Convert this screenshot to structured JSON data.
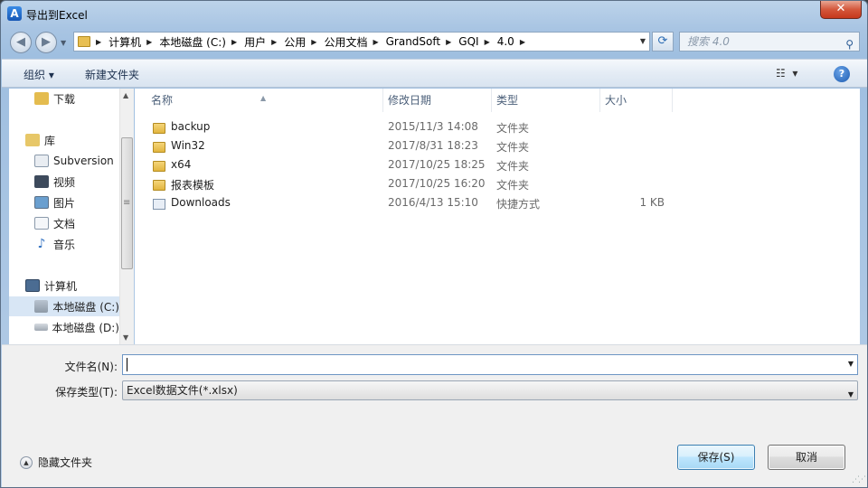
{
  "window": {
    "title": "导出到Excel",
    "app_icon_letter": "A",
    "close_glyph": "✕"
  },
  "address": {
    "crumbs": [
      "计算机",
      "本地磁盘 (C:)",
      "用户",
      "公用",
      "公用文档",
      "GrandSoft",
      "GQI",
      "4.0"
    ],
    "search_placeholder": "搜索 4.0"
  },
  "toolbar": {
    "organize_label": "组织 ▾",
    "new_folder_label": "新建文件夹",
    "help_glyph": "?"
  },
  "sidebar": {
    "items": [
      {
        "label": "下载",
        "icon": "download-folder-icon"
      },
      {
        "label": "库",
        "icon": "library-icon"
      },
      {
        "label": "Subversion",
        "icon": "subversion-library-icon"
      },
      {
        "label": "视频",
        "icon": "video-icon"
      },
      {
        "label": "图片",
        "icon": "picture-icon"
      },
      {
        "label": "文档",
        "icon": "document-icon"
      },
      {
        "label": "音乐",
        "icon": "music-icon"
      },
      {
        "label": "计算机",
        "icon": "computer-icon"
      },
      {
        "label": "本地磁盘 (C:)",
        "icon": "system-drive-icon"
      },
      {
        "label": "本地磁盘 (D:)",
        "icon": "drive-icon"
      }
    ]
  },
  "columns": {
    "name": "名称",
    "date": "修改日期",
    "type": "类型",
    "size": "大小"
  },
  "files": [
    {
      "name": "backup",
      "date": "2015/11/3 14:08",
      "type": "文件夹",
      "size": "",
      "icon": "folder-icon"
    },
    {
      "name": "Win32",
      "date": "2017/8/31 18:23",
      "type": "文件夹",
      "size": "",
      "icon": "folder-icon"
    },
    {
      "name": "x64",
      "date": "2017/10/25 18:25",
      "type": "文件夹",
      "size": "",
      "icon": "folder-icon"
    },
    {
      "name": "报表模板",
      "date": "2017/10/25 16:20",
      "type": "文件夹",
      "size": "",
      "icon": "folder-icon"
    },
    {
      "name": "Downloads",
      "date": "2016/4/13 15:10",
      "type": "快捷方式",
      "size": "1 KB",
      "icon": "shortcut-icon"
    }
  ],
  "form": {
    "filename_label": "文件名(N):",
    "filename_value": "",
    "filetype_label": "保存类型(T):",
    "filetype_value": "Excel数据文件(*.xlsx)"
  },
  "footer": {
    "hide_folders_label": "隐藏文件夹",
    "save_label": "保存(S)",
    "cancel_label": "取消"
  }
}
